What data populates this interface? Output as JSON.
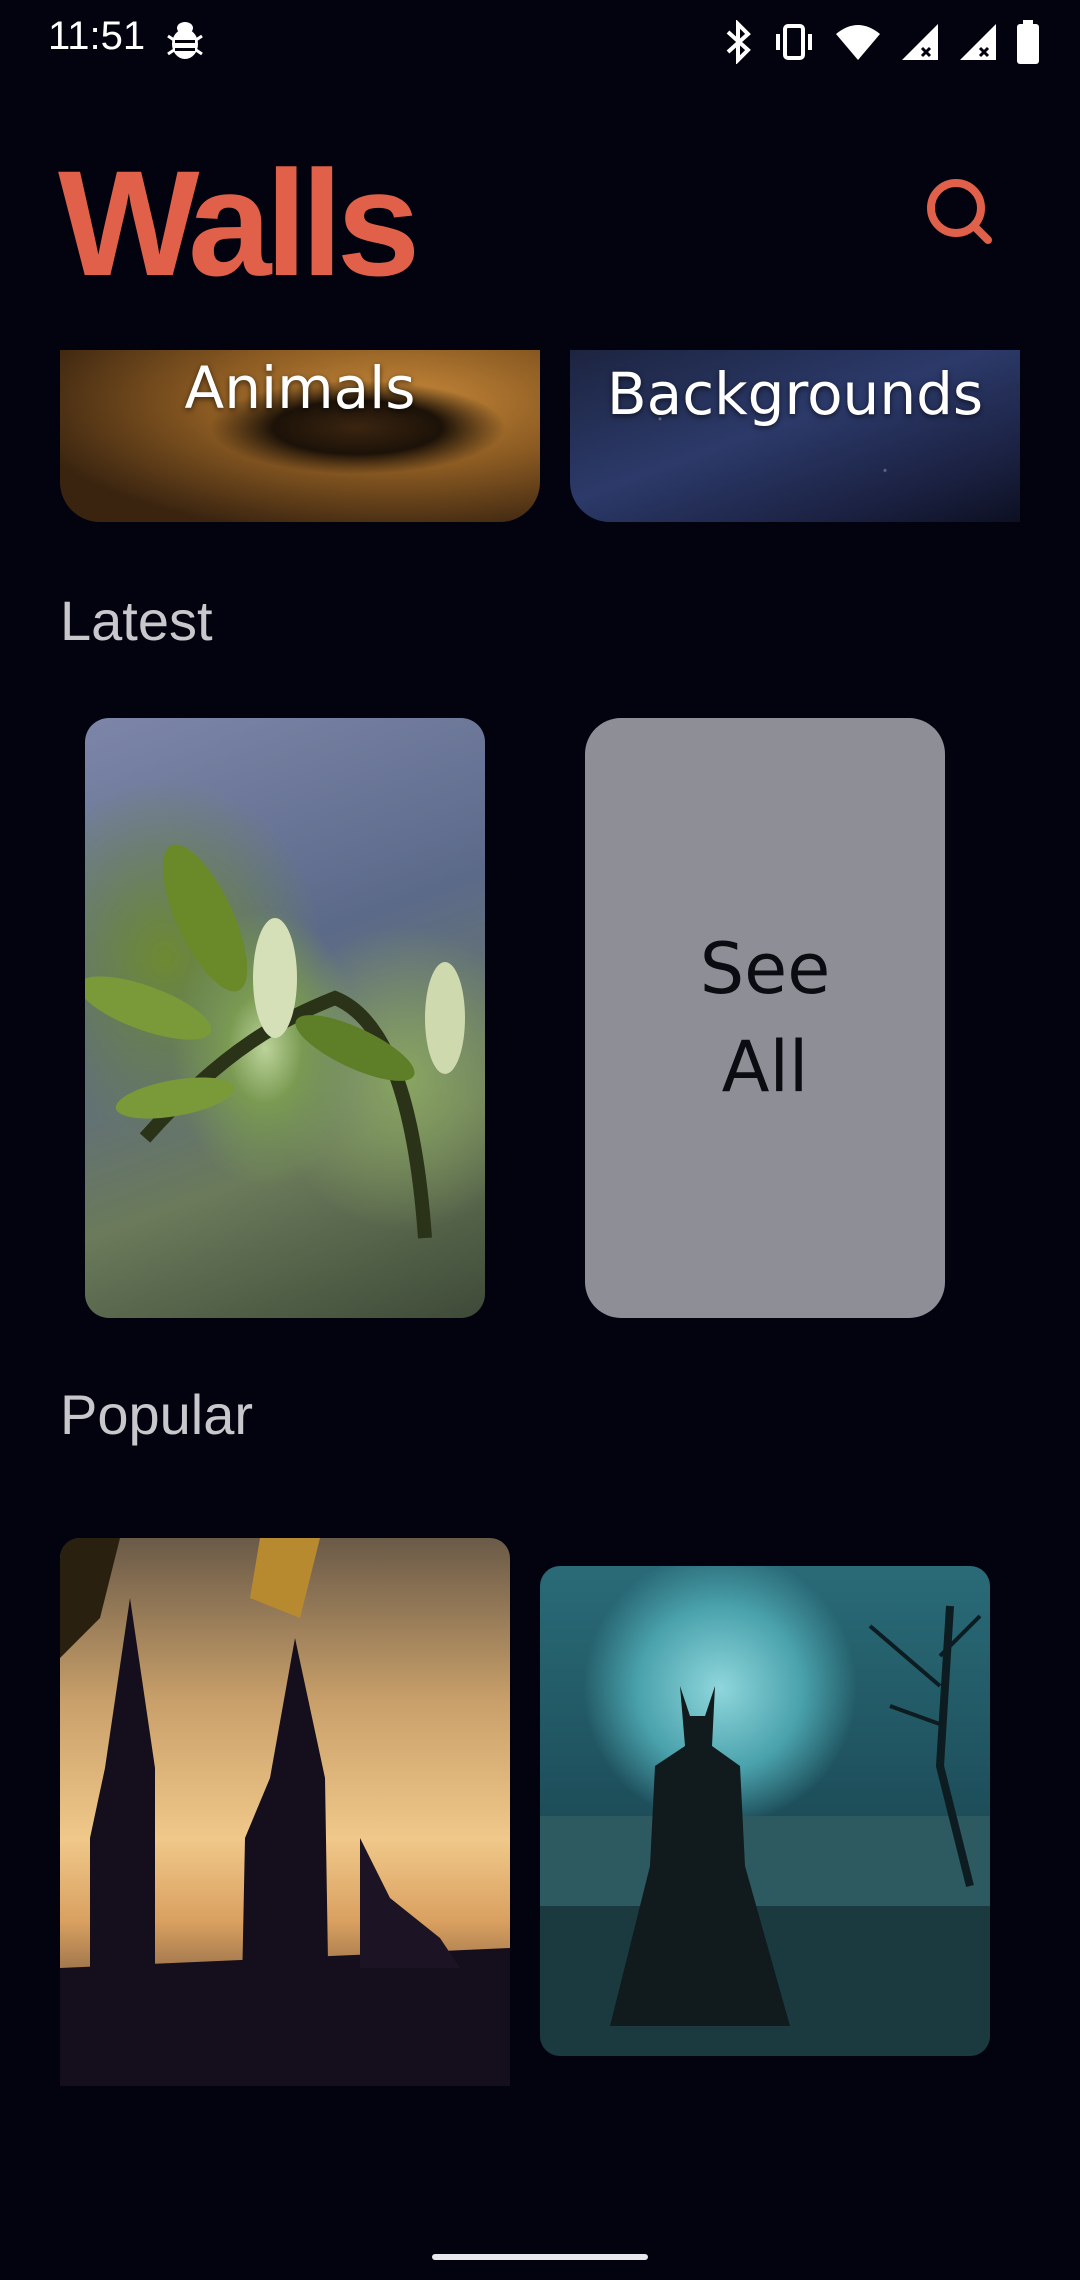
{
  "status_bar": {
    "time": "11:51",
    "icons": [
      "debug-bug-icon",
      "bluetooth-icon",
      "vibrate-icon",
      "wifi-icon",
      "signal-icon",
      "signal-icon",
      "battery-icon"
    ]
  },
  "header": {
    "title": "Walls",
    "accent_color": "#e0604a",
    "search_icon": "search-icon"
  },
  "categories": [
    {
      "label": "Animals"
    },
    {
      "label": "Backgrounds"
    }
  ],
  "sections": {
    "latest": {
      "title": "Latest",
      "see_all": "See All"
    },
    "popular": {
      "title": "Popular"
    }
  },
  "colors": {
    "background": "#03030f",
    "section_text": "#c8c8cc",
    "see_all_card": "#8e8f96"
  }
}
